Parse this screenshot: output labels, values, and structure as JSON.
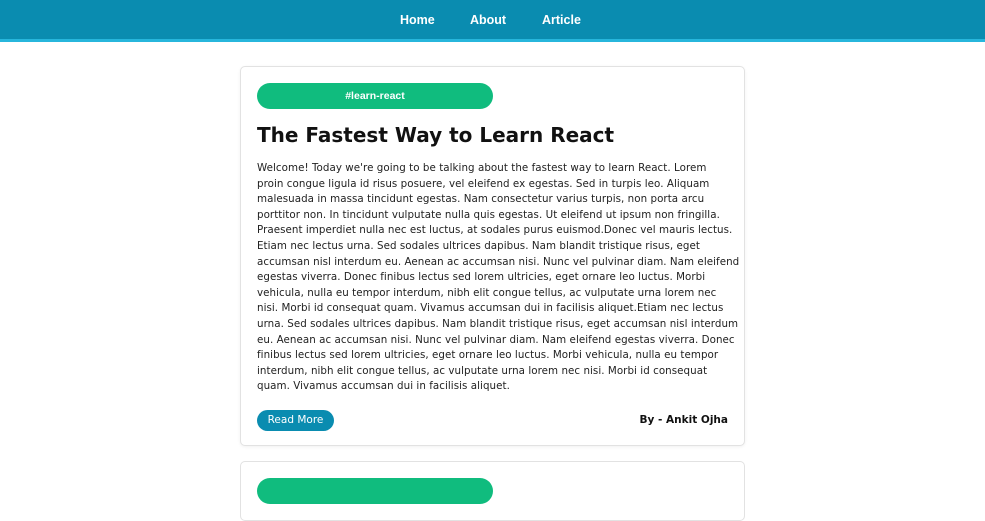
{
  "nav": {
    "items": [
      {
        "label": "Home"
      },
      {
        "label": "About"
      },
      {
        "label": "Article"
      }
    ]
  },
  "article": {
    "tag": "#learn-react",
    "title": "The Fastest Way to Learn React",
    "body_lines": [
      "Welcome! Today we're going to be talking about the fastest way to learn React. Lorem",
      "proin congue ligula id risus posuere, vel eleifend ex egestas. Sed in turpis leo. Aliquam",
      "malesuada in massa tincidunt egestas. Nam consectetur varius turpis, non porta arcu",
      "porttitor non. In tincidunt vulputate nulla quis egestas. Ut eleifend ut ipsum non fringilla.",
      "Praesent imperdiet nulla nec est luctus, at sodales purus euismod.Donec vel mauris lectus.",
      "Etiam nec lectus urna. Sed sodales ultrices dapibus. Nam blandit tristique risus, eget",
      "accumsan nisl interdum eu. Aenean ac accumsan nisi. Nunc vel pulvinar diam. Nam eleifend",
      "egestas viverra. Donec finibus lectus sed lorem ultricies, eget ornare leo luctus. Morbi",
      "vehicula, nulla eu tempor interdum, nibh elit congue tellus, ac vulputate urna lorem nec",
      "nisi. Morbi id consequat quam. Vivamus accumsan dui in facilisis aliquet.Etiam nec lectus",
      "urna. Sed sodales ultrices dapibus. Nam blandit tristique risus, eget accumsan nisl interdum",
      "eu. Aenean ac accumsan nisi. Nunc vel pulvinar diam. Nam eleifend egestas viverra. Donec",
      "finibus lectus sed lorem ultricies, eget ornare leo luctus. Morbi vehicula, nulla eu tempor",
      "interdum, nibh elit congue tellus, ac vulputate urna lorem nec nisi. Morbi id consequat",
      "quam. Vivamus accumsan dui in facilisis aliquet."
    ],
    "read_more_label": "Read More",
    "author": "By - Ankit Ojha"
  },
  "colors": {
    "navbar": "#0a8cb0",
    "navbar_border": "#27b6dc",
    "tag": "#10bc7e",
    "button": "#0a8cb0"
  }
}
